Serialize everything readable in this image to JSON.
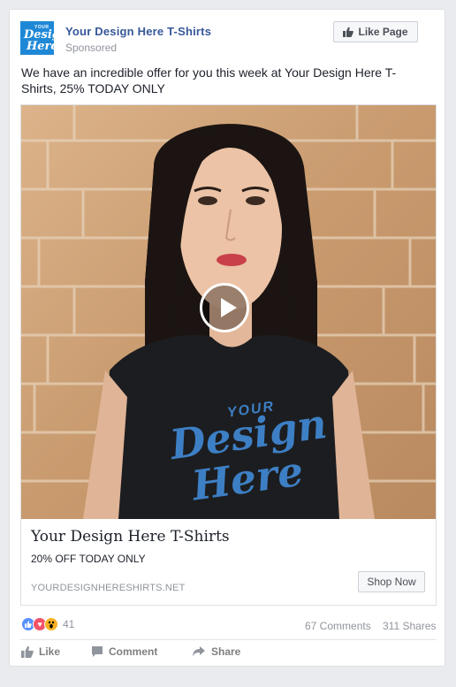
{
  "post": {
    "page_name": "Your Design Here T-Shirts",
    "sponsored": "Sponsored",
    "like_page_label": "Like Page",
    "text": "We have an incredible offer for you this week at Your Design Here T-Shirts, 25% TODAY ONLY",
    "avatar_text": [
      "YOUR",
      "Design",
      "Here"
    ]
  },
  "video": {
    "shirt_text": [
      "YOUR",
      "Design",
      "Here"
    ]
  },
  "card": {
    "title": "Your Design Here T-Shirts",
    "subtitle": "20% OFF TODAY ONLY",
    "domain": "YOURDESIGNHERESHIRTS.NET",
    "cta_label": "Shop Now"
  },
  "stats": {
    "reaction_count": "41",
    "comments": "67 Comments",
    "shares": "311 Shares"
  },
  "actions": {
    "like": "Like",
    "comment": "Comment",
    "share": "Share"
  },
  "colors": {
    "link": "#365899",
    "avatar_bg": "#1e88d6",
    "shirt_print": "#3d7fc4"
  }
}
